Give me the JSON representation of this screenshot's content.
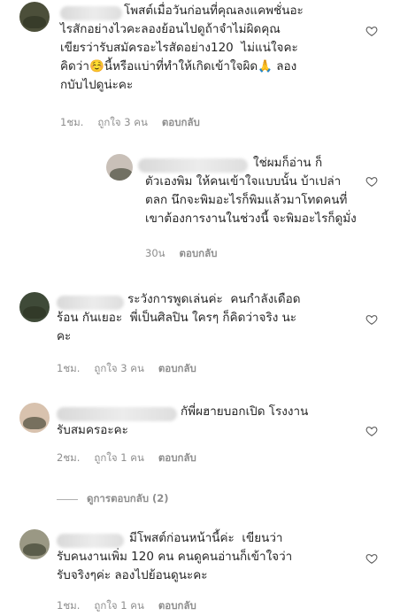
{
  "comments": [
    {
      "text": "โพสต์เมื่อวันก่อนที่คุณลงแคพชั่นอะ\nไรสักอย่างไวคะลองย้อนไปดูถ้าจำไม่ผิดคุณ\nเขียรว่ารับสมัครอะไรสัดอย่าง120  ไม่แน่ใจคะ\nคิดว่า☺️นี้หรือแบ่าที่ทำให้เกิดเข้าใจผิด🙏 ลอง\nกบับไปดูน่ะคะ",
      "time": "1ชม.",
      "likes": "ถูกใจ 3 คน",
      "reply": "ตอบกลับ"
    },
    {
      "text": "ใช่ผมก็อ่าน ก็\nตัวเองพิม ให้คนเข้าใจแบบนั้น บ้าเปล่า\nตลก นึกจะพิมอะไรก็พิมแล้วมาโทดคนที่\nเขาต้องการงานในช่วงนี้ จะพิมอะไรก็ดูมั่ง",
      "time": "30น",
      "reply": "ตอบกลับ"
    },
    {
      "text": "ระวังการพูดเล่นค่ะ  คนกำลังเดือด\nร้อน กันเยอะ  พี่เป็นศิลปิน ใครๆ ก็คิดว่าจริง นะ\nคะ",
      "time": "1ชม.",
      "likes": "ถูกใจ 3 คน",
      "reply": "ตอบกลับ"
    },
    {
      "text": "กัพี่ผฮายบอกเปิด โรงงาน\nรับสมครอะคะ",
      "time": "2ชม.",
      "likes": "ถูกใจ 1 คน",
      "reply": "ตอบกลับ"
    },
    {
      "text": "มีโพสต์ก่อนหน้านี้ค่ะ  เขียนว่า\nรับคนงานเพิ่ม 120 คน คนดูคนอ่านก็เข้าใจว่า\nรับจริงๆค่ะ ลองไปย้อนดูนะคะ",
      "time": "1ชม.",
      "likes": "ถูกใจ 1 คน",
      "reply": "ตอบกลับ"
    }
  ],
  "view_replies": "ดูการตอบกลับ (2)",
  "icons": {
    "like": "heart-outline-icon"
  }
}
